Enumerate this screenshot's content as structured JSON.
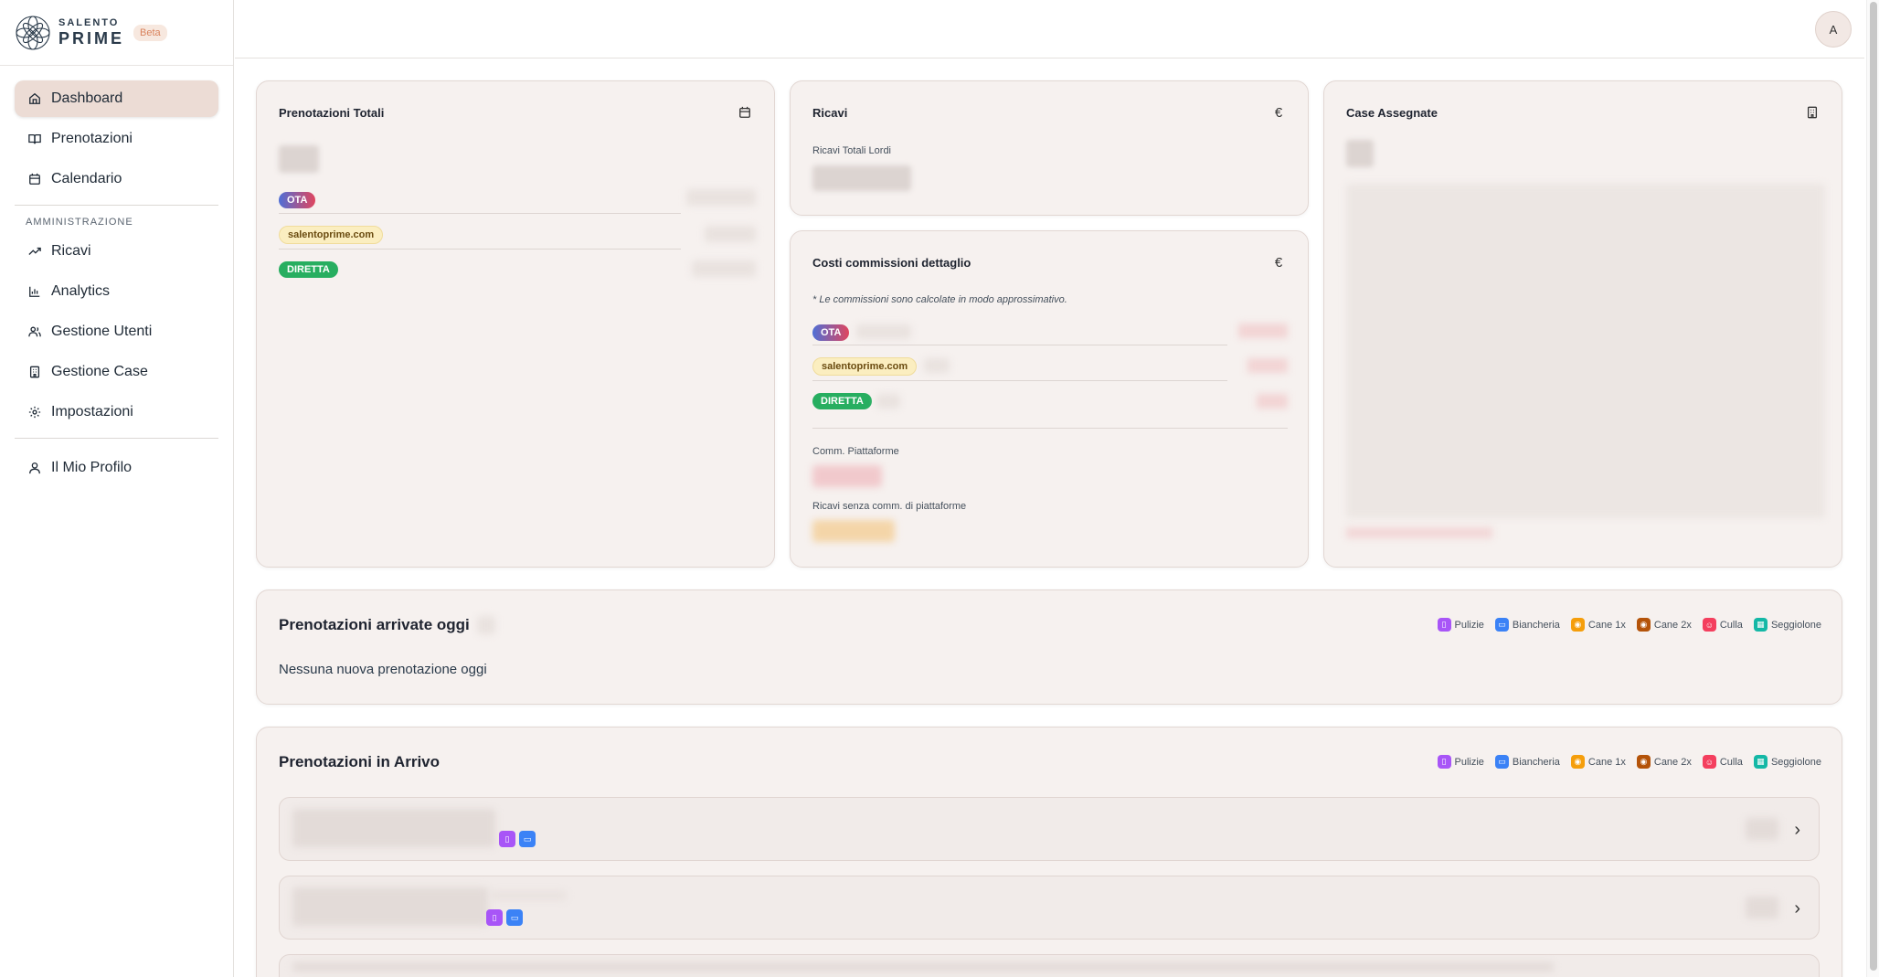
{
  "brand": {
    "line1": "SALENTO",
    "line2": "PRIME",
    "badge": "Beta"
  },
  "nav": {
    "dashboard": "Dashboard",
    "prenotazioni": "Prenotazioni",
    "calendario": "Calendario",
    "section_admin": "AMMINISTRAZIONE",
    "ricavi": "Ricavi",
    "analytics": "Analytics",
    "gestione_utenti": "Gestione Utenti",
    "gestione_case": "Gestione Case",
    "impostazioni": "Impostazioni",
    "profilo": "Il Mio Profilo"
  },
  "user": {
    "avatar_initial": "A"
  },
  "cards": {
    "prenotazioni_totali": {
      "title": "Prenotazioni Totali",
      "channels": [
        "OTA",
        "salentoprime.com",
        "DIRETTA"
      ]
    },
    "ricavi": {
      "title": "Ricavi",
      "subtitle": "Ricavi Totali Lordi",
      "currency": "€"
    },
    "costi": {
      "title": "Costi commissioni dettaglio",
      "note": "* Le commissioni sono calcolate in modo approssimativo.",
      "channels": [
        "OTA",
        "salentoprime.com",
        "DIRETTA"
      ],
      "comm_label": "Comm. Piattaforme",
      "senza_label": "Ricavi senza comm. di piattaforme",
      "currency": "€"
    },
    "case": {
      "title": "Case Assegnate"
    }
  },
  "today": {
    "title": "Prenotazioni arrivate oggi",
    "empty": "Nessuna nuova prenotazione oggi"
  },
  "incoming": {
    "title": "Prenotazioni in Arrivo"
  },
  "legend": [
    "Pulizie",
    "Biancheria",
    "Cane 1x",
    "Cane 2x",
    "Culla",
    "Seggiolone"
  ],
  "legend_colors": {
    "pulizie": "#a855f7",
    "biancheria": "#3b82f6",
    "cane1": "#f59e0b",
    "cane2": "#b45309",
    "culla": "#f43f5e",
    "seggiolone": "#14b8a6"
  }
}
